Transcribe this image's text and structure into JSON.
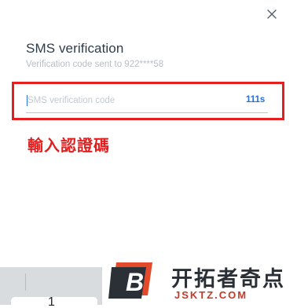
{
  "dialog": {
    "title": "SMS verification",
    "subtitle": "Verification code sent to 922****58",
    "close_icon": "close-icon"
  },
  "input": {
    "placeholder": "SMS verification code",
    "value": "",
    "countdown": "111s"
  },
  "annotation": {
    "text": "輸入認證碼",
    "color": "#e41f1f"
  },
  "keypad": {
    "key_label": "1"
  },
  "watermark": {
    "logo_letter": "B",
    "name": "开拓者奇点",
    "url": "JSKTZ.COM"
  },
  "colors": {
    "accent": "#2b6fd6",
    "annotation_red": "#e41f1f"
  }
}
